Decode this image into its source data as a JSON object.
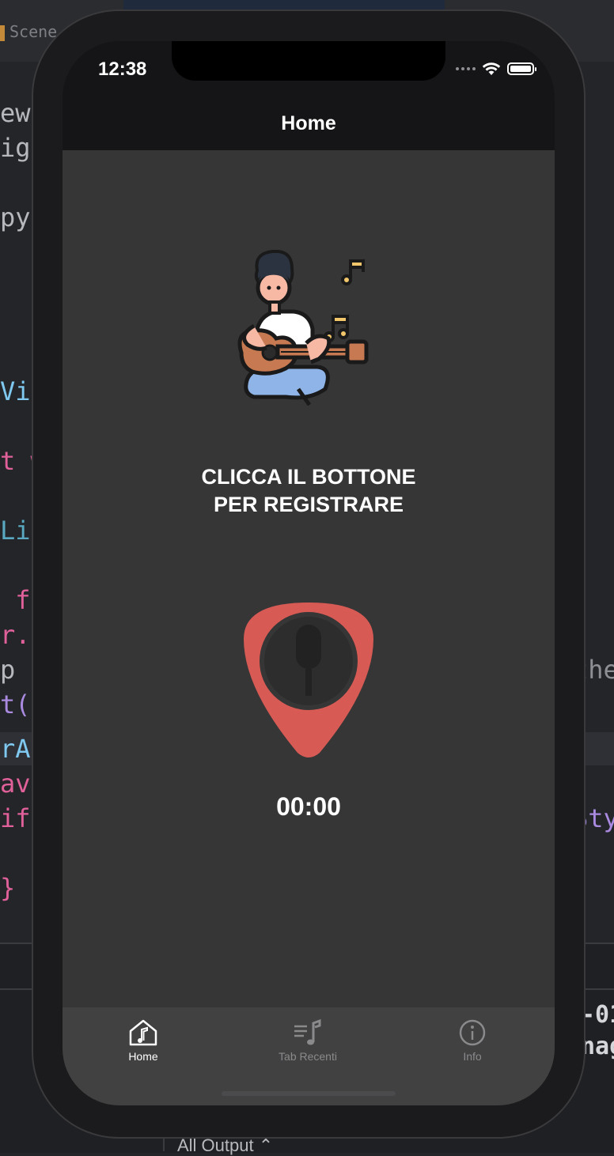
{
  "background": {
    "scene_label": "Scene",
    "code_lines_left": [
      {
        "text": "ewC",
        "color": "#b6b8bd"
      },
      {
        "text": "igi",
        "color": "#b6b8bd"
      },
      {
        "text": "py",
        "color": "#b6b8bd"
      },
      {
        "text": "Vie",
        "color": "#7fc8ef"
      },
      {
        "text": "t w",
        "color": "#e0609a"
      },
      {
        "text": "Lis",
        "color": "#5aa9c2"
      },
      {
        "text": " fu",
        "color": "#e0609a"
      },
      {
        "text": "r.v",
        "color": "#e0609a"
      },
      {
        "text": "p a",
        "color": "#b6b8bd"
      },
      {
        "text": "t('",
        "color": "#a98ae0"
      },
      {
        "text": "rAl",
        "color": "#7fc8ef"
      },
      {
        "text": "ava",
        "color": "#e0609a"
      },
      {
        "text": "if",
        "color": "#e0609a"
      },
      {
        "text": "} e",
        "color": "#e0609a"
      }
    ],
    "code_lines_right": [
      {
        "text": "the",
        "color": "#8d8f95"
      },
      {
        "text": "Sty",
        "color": "#a98ae0"
      },
      {
        "text": "-01",
        "color": "#d5d6d9"
      },
      {
        "text": "nag",
        "color": "#d5d6d9"
      }
    ],
    "output_label": "All Output ⌃"
  },
  "status_bar": {
    "time": "12:38"
  },
  "nav": {
    "title": "Home"
  },
  "main": {
    "illustration": "guitar-player-illustration",
    "prompt_line1": "CLICCA IL BOTTONE",
    "prompt_line2": "PER REGISTRARE",
    "record_button_icon": "microphone-icon",
    "timer": "00:00",
    "accent_color": "#d85a55"
  },
  "tabbar": {
    "tabs": [
      {
        "label": "Home",
        "icon": "home-music-icon",
        "active": true
      },
      {
        "label": "Tab Recenti",
        "icon": "music-list-icon",
        "active": false
      },
      {
        "label": "Info",
        "icon": "info-icon",
        "active": false
      }
    ]
  }
}
